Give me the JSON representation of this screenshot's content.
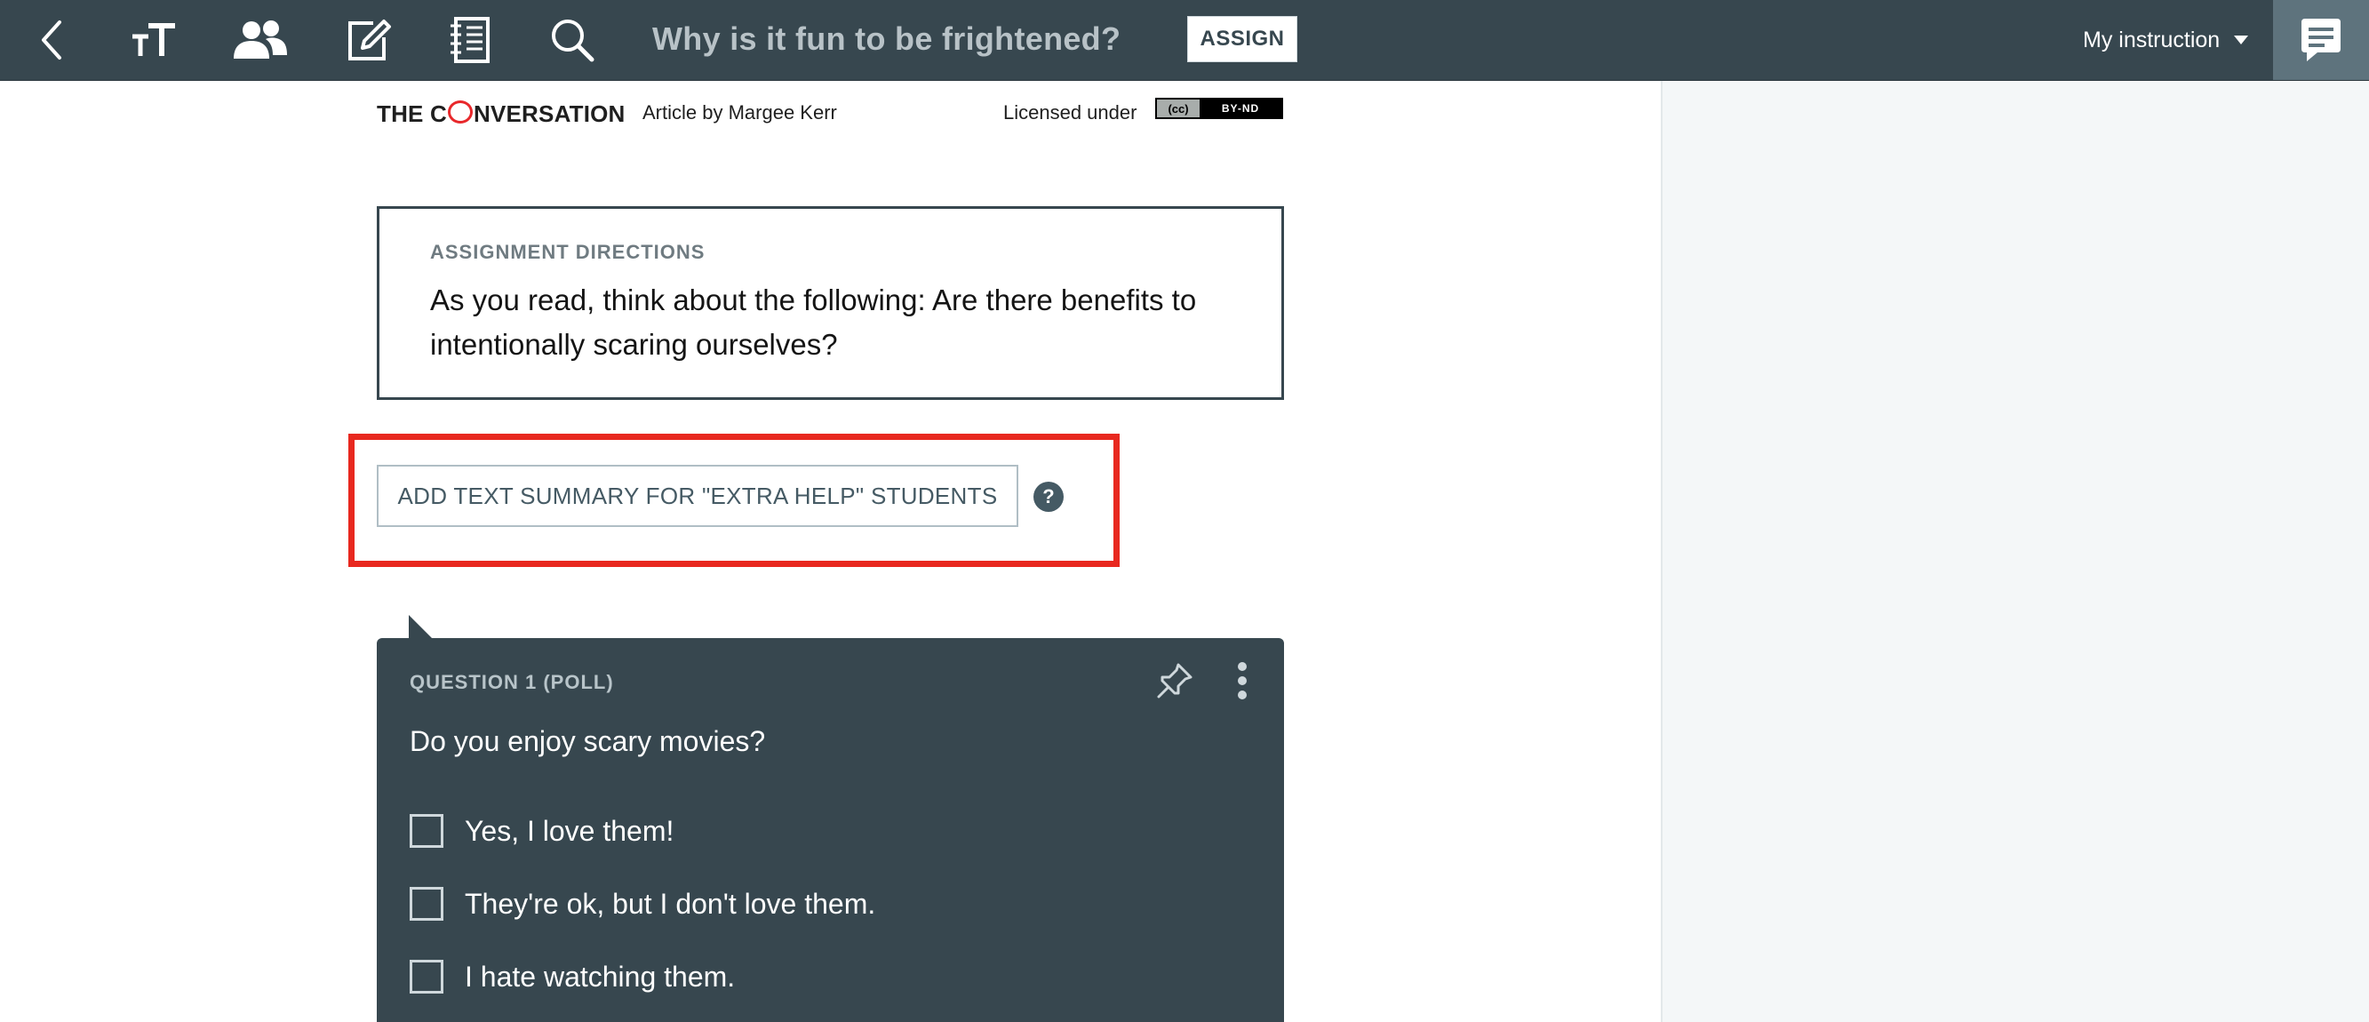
{
  "toolbar": {
    "icons": [
      "back-icon",
      "text-size-icon",
      "people-icon",
      "edit-icon",
      "notebook-icon",
      "search-icon"
    ],
    "title": "Why is it fun to be frightened?",
    "assign_label": "ASSIGN",
    "instruction_label": "My instruction"
  },
  "article": {
    "brand_prefix": "THE C",
    "brand_suffix": "NVERSATION",
    "byline": "Article by Margee Kerr",
    "license_text": "Licensed under",
    "license_badge_left": "(cc)",
    "license_badge_right": "BY-ND"
  },
  "directions": {
    "heading": "ASSIGNMENT DIRECTIONS",
    "body": "As you read, think about the following: Are there benefits to intentionally scaring ourselves?"
  },
  "summary": {
    "button_label": "ADD TEXT SUMMARY FOR \"EXTRA HELP\" STUDENTS",
    "help_label": "?"
  },
  "question": {
    "label": "QUESTION 1 (POLL)",
    "text": "Do you enjoy scary movies?",
    "options": [
      "Yes, I love them!",
      "They're ok, but I don't love them.",
      "I hate watching them."
    ]
  },
  "colors": {
    "toolbar_bg": "#37474f",
    "highlight": "#e8281f",
    "card_bg": "#37474f"
  }
}
